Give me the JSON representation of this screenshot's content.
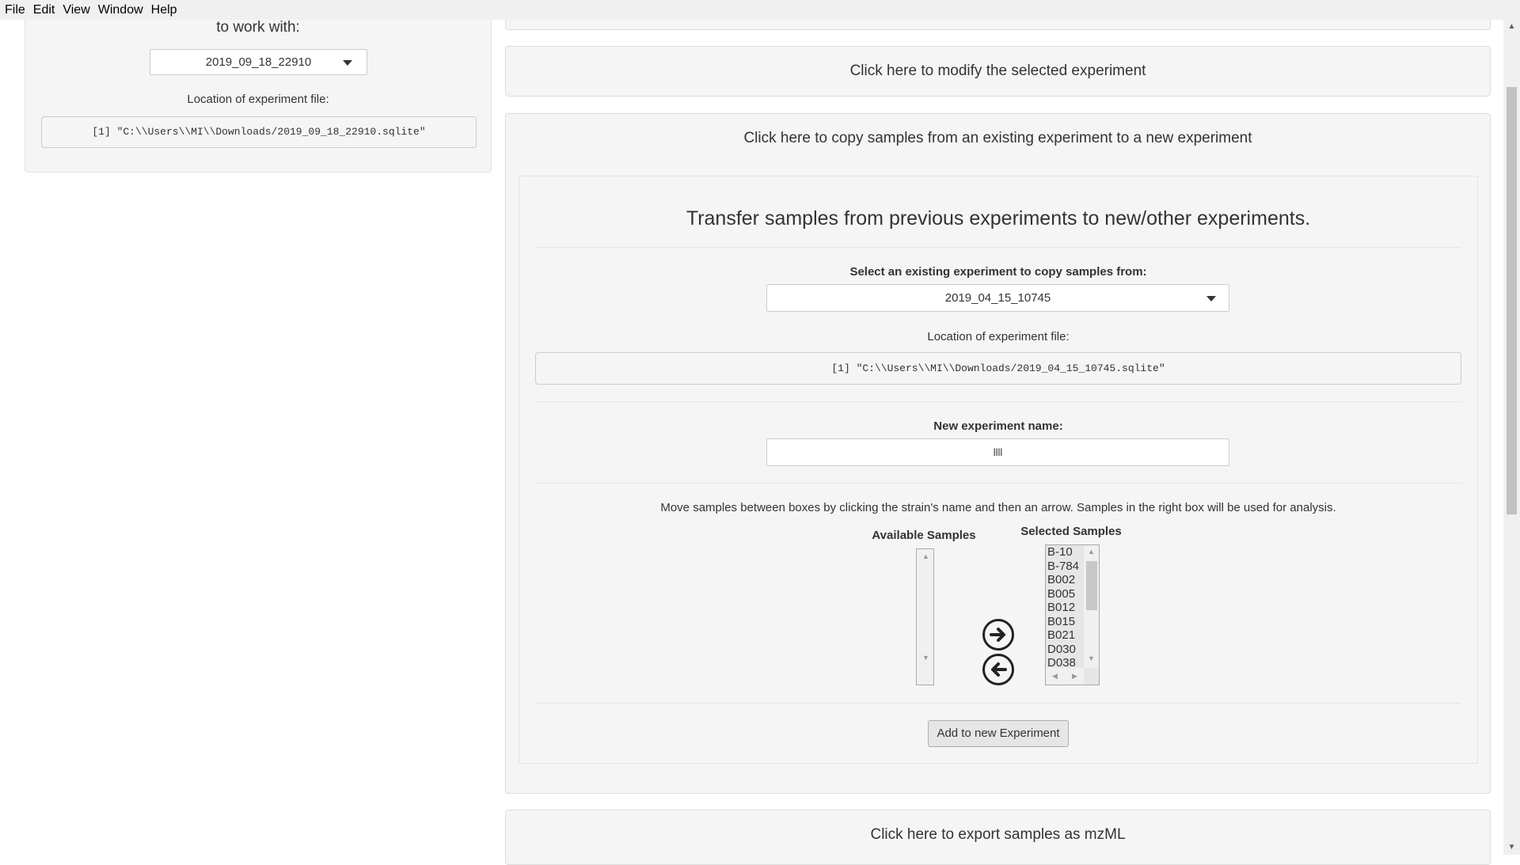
{
  "menu": [
    "File",
    "Edit",
    "View",
    "Window",
    "Help"
  ],
  "left_panel": {
    "heading_fragment": "to work with:",
    "selected_experiment": "2019_09_18_22910",
    "location_label": "Location of experiment file:",
    "location_value": "[1] \"C:\\\\Users\\\\MI\\\\Downloads/2019_09_18_22910.sqlite\""
  },
  "bars": {
    "modify": "Click here to modify the selected experiment",
    "copy": "Click here to copy samples from an existing experiment to a new experiment",
    "export": "Click here to export samples as mzML"
  },
  "transfer": {
    "title": "Transfer samples from previous experiments to new/other experiments.",
    "select_label": "Select an existing experiment to copy samples from:",
    "selected_source": "2019_04_15_10745",
    "location_label": "Location of experiment file:",
    "location_value": "[1] \"C:\\\\Users\\\\MI\\\\Downloads/2019_04_15_10745.sqlite\"",
    "new_name_label": "New experiment name:",
    "new_name_value": "llll",
    "instructions": "Move samples between boxes by clicking the strain's name and then an arrow. Samples in the right box will be used for analysis.",
    "available_label": "Available Samples",
    "selected_label": "Selected Samples",
    "selected_samples": [
      "B-10",
      "B-784",
      "B002",
      "B005",
      "B012",
      "B015",
      "B021",
      "D030",
      "D038"
    ],
    "add_button": "Add to new Experiment"
  },
  "icons": {
    "move_right": "arrow-circle-right-icon",
    "move_left": "arrow-circle-left-icon",
    "dropdown": "caret-down-icon"
  }
}
